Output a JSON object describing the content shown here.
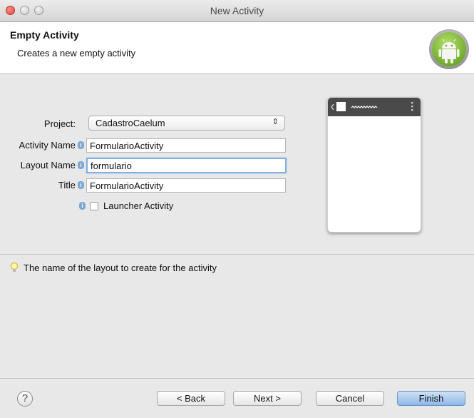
{
  "window": {
    "title": "New Activity"
  },
  "header": {
    "title": "Empty Activity",
    "description": "Creates a new empty activity",
    "logo_icon": "android-logo-icon"
  },
  "form": {
    "project_label": "Project:",
    "project_value": "CadastroCaelum",
    "activity_name_label": "Activity Name",
    "activity_name_value": "FormularioActivity",
    "layout_name_label": "Layout Name",
    "layout_name_value": "formulario",
    "title_label": "Title",
    "title_value": "FormularioActivity",
    "launcher_label": "Launcher Activity",
    "launcher_checked": false,
    "info_icon": "info-icon"
  },
  "hint": {
    "icon": "lightbulb-icon",
    "text": "The name of the layout to create for the activity"
  },
  "buttons": {
    "help": "?",
    "back": "< Back",
    "next": "Next >",
    "cancel": "Cancel",
    "finish": "Finish"
  },
  "colors": {
    "android_green": "#8cc63f",
    "accent_blue": "#82aee0"
  }
}
